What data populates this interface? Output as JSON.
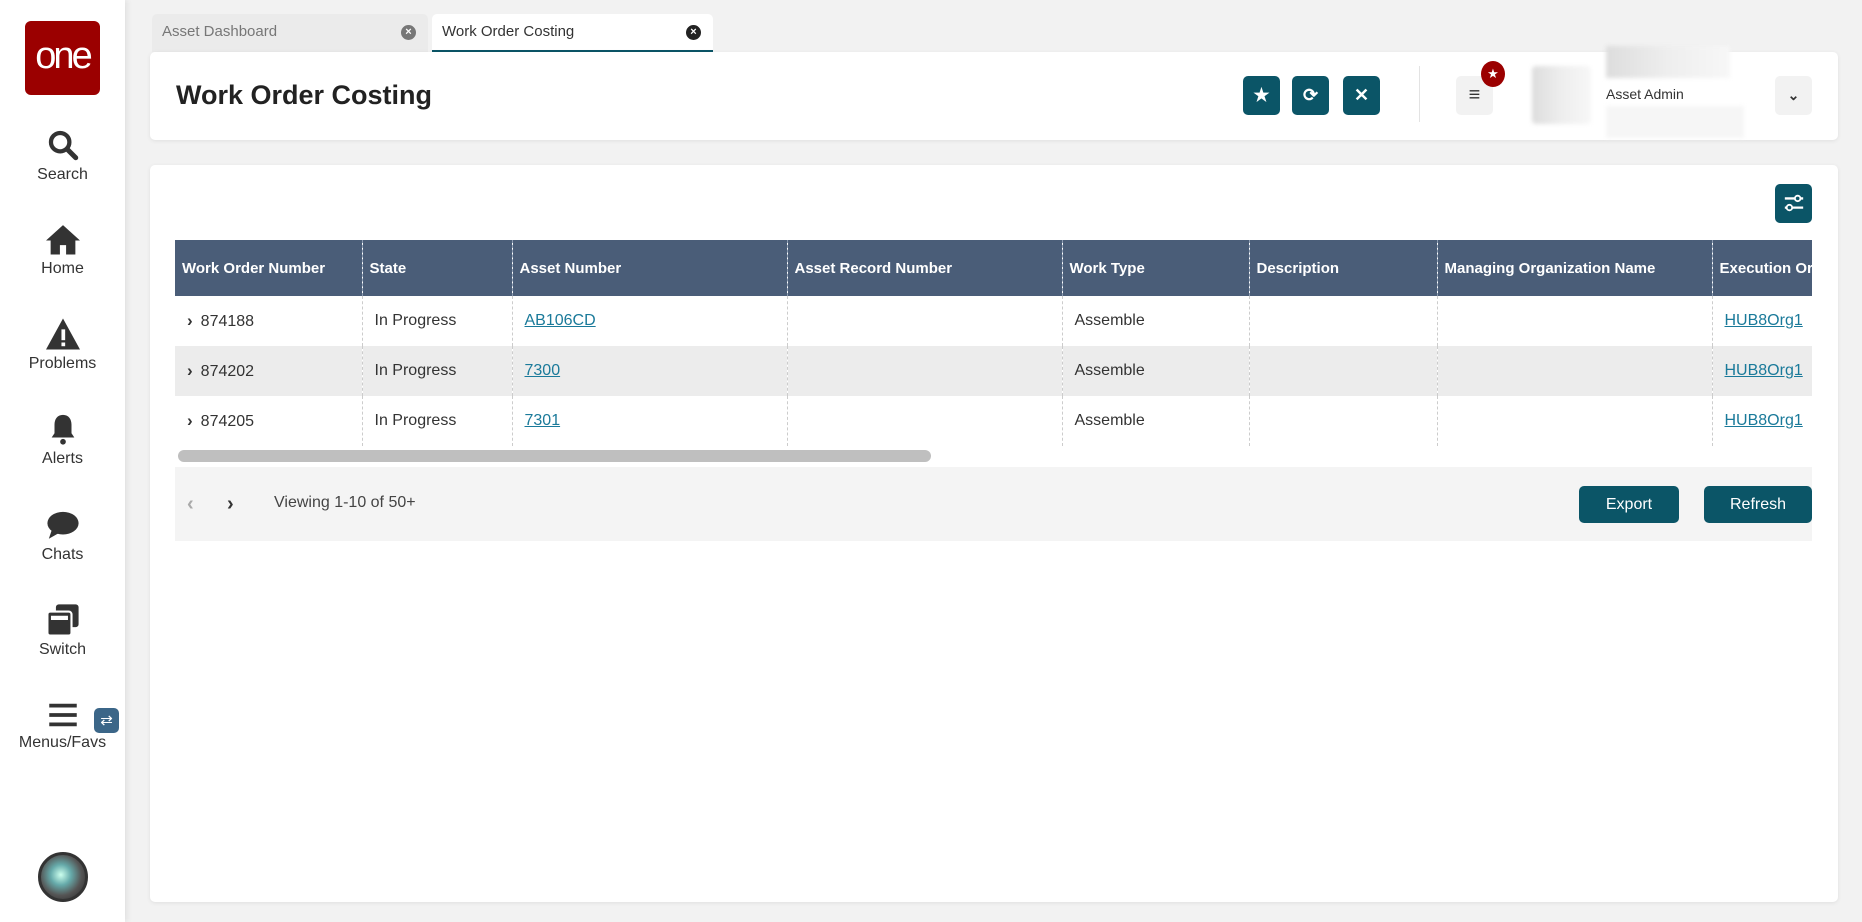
{
  "logo": "one",
  "sidebar": {
    "items": [
      {
        "label": "Search",
        "icon": "search-icon"
      },
      {
        "label": "Home",
        "icon": "home-icon"
      },
      {
        "label": "Problems",
        "icon": "warning-icon"
      },
      {
        "label": "Alerts",
        "icon": "bell-icon"
      },
      {
        "label": "Chats",
        "icon": "chat-icon"
      },
      {
        "label": "Switch",
        "icon": "switch-icon"
      },
      {
        "label": "Menus/Favs",
        "icon": "menu-icon"
      }
    ],
    "switch_badge": "⇄"
  },
  "tabs": [
    {
      "label": "Asset Dashboard",
      "active": false
    },
    {
      "label": "Work Order Costing",
      "active": true
    }
  ],
  "header": {
    "title": "Work Order Costing",
    "user_role": "Asset Admin"
  },
  "table": {
    "columns": [
      "Work Order Number",
      "State",
      "Asset Number",
      "Asset Record Number",
      "Work Type",
      "Description",
      "Managing Organization Name",
      "Execution Or"
    ],
    "rows": [
      {
        "wo": "874188",
        "state": "In Progress",
        "asset": "AB106CD",
        "record": "",
        "type": "Assemble",
        "desc": "",
        "mgr": "",
        "exec": "HUB8Org1"
      },
      {
        "wo": "874202",
        "state": "In Progress",
        "asset": "7300",
        "record": "",
        "type": "Assemble",
        "desc": "",
        "mgr": "",
        "exec": "HUB8Org1"
      },
      {
        "wo": "874205",
        "state": "In Progress",
        "asset": "7301",
        "record": "",
        "type": "Assemble",
        "desc": "",
        "mgr": "",
        "exec": "HUB8Org1"
      }
    ]
  },
  "footer": {
    "viewing": "Viewing 1-10 of 50+",
    "export": "Export",
    "refresh": "Refresh"
  },
  "colors": {
    "accent": "#0b5567",
    "header": "#4a5d78",
    "brand": "#9b0000"
  }
}
